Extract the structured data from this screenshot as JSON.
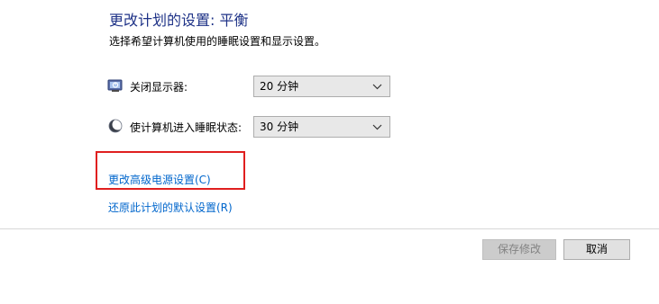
{
  "header": {
    "title": "更改计划的设置: 平衡",
    "subtitle": "选择希望计算机使用的睡眠设置和显示设置。"
  },
  "settings": [
    {
      "label": "关闭显示器:",
      "value": "20 分钟",
      "icon": "monitor-power-icon"
    },
    {
      "label": "使计算机进入睡眠状态:",
      "value": "30 分钟",
      "icon": "sleep-moon-icon"
    }
  ],
  "links": {
    "advanced": "更改高级电源设置(C)",
    "restore": "还原此计划的默认设置(R)"
  },
  "buttons": {
    "save": "保存修改",
    "cancel": "取消"
  },
  "colors": {
    "title": "#1e3287",
    "link": "#0066cc",
    "highlight_box": "#e01f1f"
  }
}
